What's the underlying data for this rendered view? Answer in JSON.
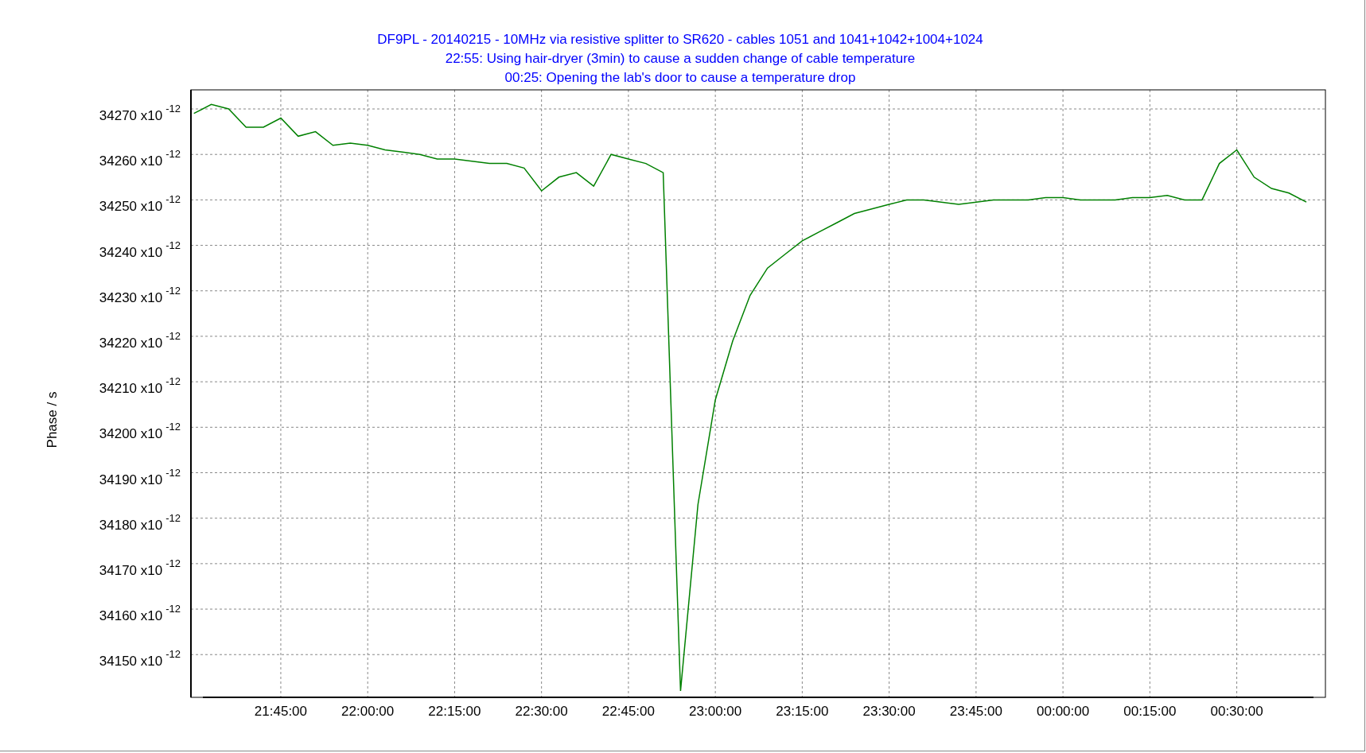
{
  "plot": {
    "chart_data": {
      "type": "line",
      "grid": true,
      "title": "DF9PL - 20140215 - 10MHz via resistive splitter to SR620 - cables 1051 and 1041+1042+1004+1024",
      "annotations": [
        "22:55: Using hair-dryer (3min) to cause a sudden change of cable temperature",
        "00:25: Opening the lab's door to cause a temperature drop"
      ],
      "ylabel": "Phase / s",
      "categories": [
        null,
        null,
        null,
        null,
        null,
        "21:45:00",
        null,
        null,
        null,
        null,
        "22:00:00",
        null,
        null,
        null,
        null,
        "22:15:00",
        null,
        null,
        null,
        null,
        "22:30:00",
        null,
        null,
        null,
        null,
        "22:45:00",
        null,
        null,
        null,
        null,
        "23:00:00",
        null,
        null,
        null,
        null,
        "23:15:00",
        null,
        null,
        null,
        null,
        "23:30:00",
        null,
        null,
        null,
        null,
        "23:45:00",
        null,
        null,
        null,
        null,
        "00:00:00",
        null,
        null,
        null,
        null,
        "00:15:00",
        null,
        null,
        null,
        null,
        "00:30:00",
        null,
        null,
        null,
        null,
        null
      ],
      "series": [
        {
          "color": "#008000",
          "values": [
            3.4269e-08,
            3.4271e-08,
            3.427e-08,
            3.4266e-08,
            3.4266e-08,
            3.4268e-08,
            3.4264e-08,
            3.4265e-08,
            3.4262e-08,
            3.42625e-08,
            3.4262e-08,
            3.4261e-08,
            3.42605e-08,
            3.426e-08,
            3.4259e-08,
            3.4259e-08,
            3.42585e-08,
            3.4258e-08,
            3.4258e-08,
            3.4257e-08,
            3.4252e-08,
            3.4255e-08,
            3.4256e-08,
            3.4253e-08,
            3.426e-08,
            3.4259e-08,
            3.4258e-08,
            3.4256e-08,
            3.4142e-08,
            3.4183e-08,
            3.4206e-08,
            3.4219e-08,
            3.4229e-08,
            3.4235e-08,
            3.4238e-08,
            3.4241e-08,
            3.4243e-08,
            3.4245e-08,
            3.4247e-08,
            3.4248e-08,
            3.4249e-08,
            3.425e-08,
            3.425e-08,
            3.42495e-08,
            3.4249e-08,
            3.42495e-08,
            3.425e-08,
            3.425e-08,
            3.425e-08,
            3.42505e-08,
            3.42505e-08,
            3.425e-08,
            3.425e-08,
            3.425e-08,
            3.42505e-08,
            3.42505e-08,
            3.4251e-08,
            3.425e-08,
            3.425e-08,
            3.4258e-08,
            3.4261e-08,
            3.4255e-08,
            3.42525e-08,
            3.42515e-08,
            3.42495e-08,
            null
          ]
        }
      ],
      "ylim": [
        3.41406e-08,
        3.42742e-08
      ],
      "yticks": [
        {
          "value": 3.427e-08,
          "label": "34270 x10$^{-12}$"
        },
        {
          "value": 3.426e-08,
          "label": "34260 x10$^{-12}$"
        },
        {
          "value": 3.425e-08,
          "label": "34250 x10$^{-12}$"
        },
        {
          "value": 3.424e-08,
          "label": "34240 x10$^{-12}$"
        },
        {
          "value": 3.423e-08,
          "label": "34230 x10$^{-12}$"
        },
        {
          "value": 3.422e-08,
          "label": "34220 x10$^{-12}$"
        },
        {
          "value": 3.421e-08,
          "label": "34210 x10$^{-12}$"
        },
        {
          "value": 3.42e-08,
          "label": "34200 x10$^{-12}$"
        },
        {
          "value": 3.419e-08,
          "label": "34190 x10$^{-12}$"
        },
        {
          "value": 3.418e-08,
          "label": "34180 x10$^{-12}$"
        },
        {
          "value": 3.417e-08,
          "label": "34170 x10$^{-12}$"
        },
        {
          "value": 3.416e-08,
          "label": "34160 x10$^{-12}$"
        },
        {
          "value": 3.415e-08,
          "label": "34150 x10$^{-12}$"
        }
      ]
    }
  }
}
